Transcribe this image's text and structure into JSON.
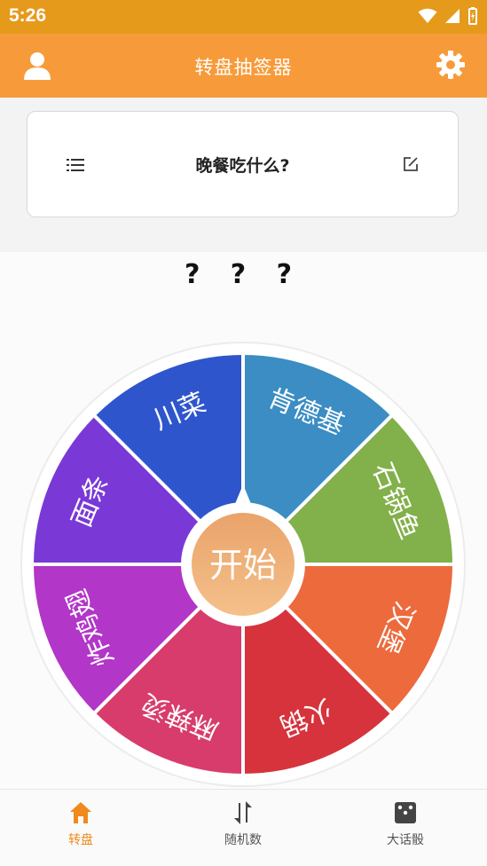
{
  "status": {
    "time": "5:26"
  },
  "header": {
    "title": "转盘抽签器",
    "user_icon": "user-icon",
    "settings_icon": "gear-icon"
  },
  "card": {
    "question": "晚餐吃什么?",
    "list_icon": "list-icon",
    "edit_icon": "edit-icon"
  },
  "result": "? ? ?",
  "wheel": {
    "start_label": "开始",
    "segments": [
      {
        "label": "肯德基",
        "color": "#3b8dc3"
      },
      {
        "label": "石锅鱼",
        "color": "#82b04a"
      },
      {
        "label": "汉堡",
        "color": "#ec6a3c"
      },
      {
        "label": "火锅",
        "color": "#d6333c"
      },
      {
        "label": "麻辣烫",
        "color": "#d83c6c"
      },
      {
        "label": "炸鸡翅",
        "color": "#b236c8"
      },
      {
        "label": "面条",
        "color": "#7a39d6"
      },
      {
        "label": "川菜",
        "color": "#2e55cc"
      }
    ]
  },
  "tabs": [
    {
      "label": "转盘",
      "icon": "home-icon",
      "active": true
    },
    {
      "label": "随机数",
      "icon": "shuffle-icon",
      "active": false
    },
    {
      "label": "大话骰",
      "icon": "dice-icon",
      "active": false
    }
  ],
  "colors": {
    "accent": "#f79b3a",
    "statusbar": "#e69a1c",
    "active_tab": "#f08a1c"
  }
}
